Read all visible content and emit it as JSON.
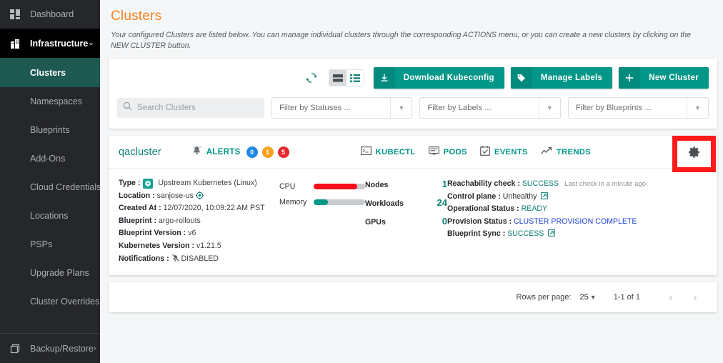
{
  "sidebar": {
    "items": [
      {
        "label": "Dashboard",
        "icon": "dashboard-icon",
        "type": "item"
      },
      {
        "label": "Infrastructure",
        "icon": "infrastructure-icon",
        "type": "group",
        "chevron": "⌄"
      },
      {
        "label": "Clusters",
        "icon": "",
        "type": "sub-active"
      },
      {
        "label": "Namespaces",
        "icon": "",
        "type": "sub"
      },
      {
        "label": "Blueprints",
        "icon": "",
        "type": "sub"
      },
      {
        "label": "Add-Ons",
        "icon": "",
        "type": "sub"
      },
      {
        "label": "Cloud Credentials",
        "icon": "",
        "type": "sub"
      },
      {
        "label": "Locations",
        "icon": "",
        "type": "sub"
      },
      {
        "label": "PSPs",
        "icon": "",
        "type": "sub"
      },
      {
        "label": "Upgrade Plans",
        "icon": "",
        "type": "sub"
      },
      {
        "label": "Cluster Overrides",
        "icon": "",
        "type": "sub"
      }
    ],
    "bottom": {
      "label": "Backup/Restore",
      "icon": "backup-restore-icon",
      "chevron": "›"
    }
  },
  "page": {
    "title": "Clusters",
    "description": "Your configured Clusters are listed below. You can manage individual clusters through the corresponding ACTIONS menu, or you can create a new clusters by clicking on the NEW CLUSTER button.",
    "title_color": "#f58220"
  },
  "toolbar": {
    "refresh_icon": "refresh-icon",
    "view_card_icon": "card-view-icon",
    "view_list_icon": "list-view-icon",
    "view_selected": "card",
    "buttons": [
      {
        "label": "Download Kubeconfig",
        "icon": "download-icon"
      },
      {
        "label": "Manage Labels",
        "icon": "label-tag-icon"
      },
      {
        "label": "New Cluster",
        "icon": "plus-icon"
      }
    ],
    "accent": "#009688"
  },
  "filters": {
    "search": {
      "placeholder": "Search Clusters",
      "value": ""
    },
    "statuses": {
      "label": "Filter by Statuses ..."
    },
    "labels": {
      "label": "Filter by Labels ..."
    },
    "blueprints": {
      "label": "Filter by Blueprints ..."
    }
  },
  "cluster": {
    "name": "qacluster",
    "alerts": {
      "label": "ALERTS",
      "badges": [
        {
          "count": "0",
          "color": "#1e88e5"
        },
        {
          "count": "1",
          "color": "#f7a21c"
        },
        {
          "count": "5",
          "color": "#e8272c"
        }
      ]
    },
    "actions": [
      {
        "label": "KUBECTL",
        "icon": "terminal-icon"
      },
      {
        "label": "PODS",
        "icon": "pods-icon"
      },
      {
        "label": "EVENTS",
        "icon": "calendar-check-icon"
      },
      {
        "label": "TRENDS",
        "icon": "trend-line-icon"
      }
    ],
    "settings_icon": "gear-icon",
    "highlight_color": "#fb1b1b",
    "details": [
      {
        "key": "Type :",
        "value": "Upstream Kubernetes (Linux)",
        "icon": "kubernetes-icon"
      },
      {
        "key": "Location :",
        "value": "sanjose-us",
        "icon": "location-target-icon"
      },
      {
        "key": "Created At :",
        "value": "12/07/2020, 10:09:22 AM PST"
      },
      {
        "key": "Blueprint :",
        "value": "argo-rollouts"
      },
      {
        "key": "Blueprint Version :",
        "value": "v6"
      },
      {
        "key": "Kubernetes Version :",
        "value": "v1.21.5"
      },
      {
        "key": "Notifications :",
        "value": "DISABLED",
        "icon": "bell-off-icon"
      }
    ],
    "meters": [
      {
        "label": "CPU",
        "percent": 84,
        "color": "#fb0d1b"
      },
      {
        "label": "Memory",
        "percent": 28,
        "color": "#009688"
      }
    ],
    "counts": [
      {
        "label": "Nodes",
        "value": "1"
      },
      {
        "label": "Workloads",
        "value": "24"
      },
      {
        "label": "GPUs",
        "value": "0"
      }
    ],
    "statuses": [
      {
        "key": "Reachability check :",
        "value": "SUCCESS",
        "style": "ok",
        "note": "Last check in a minute ago"
      },
      {
        "key": "Control plane :",
        "value": "Unhealthy",
        "style": "plain",
        "external": true
      },
      {
        "key": "Operational Status :",
        "value": "READY",
        "style": "ok"
      },
      {
        "key": "Provision Status :",
        "value": "CLUSTER PROVISION COMPLETE",
        "style": "blue"
      },
      {
        "key": "Blueprint Sync :",
        "value": "SUCCESS",
        "style": "ok",
        "external": true
      }
    ]
  },
  "pagination": {
    "rows_label": "Rows per page:",
    "rows_value": "25",
    "range": "1-1 of 1",
    "prev_icon": "chevron-left-icon",
    "next_icon": "chevron-right-icon",
    "prev": "‹",
    "next": "›"
  }
}
